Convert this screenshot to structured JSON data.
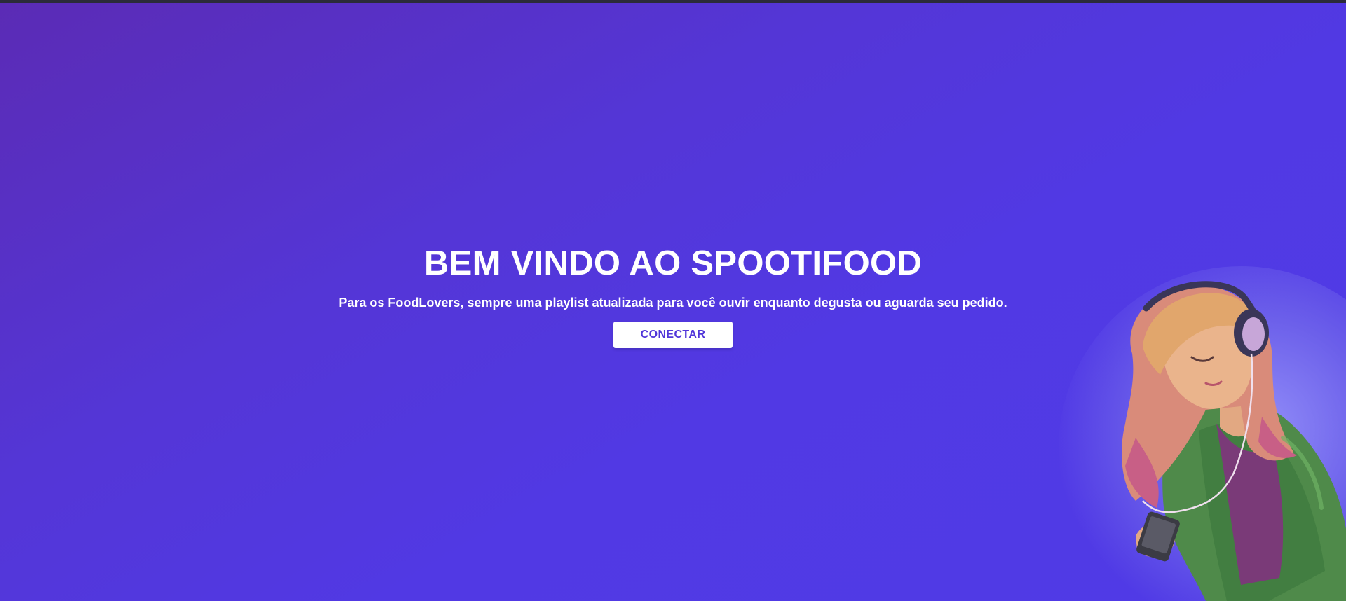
{
  "hero": {
    "title": "BEM VINDO AO SPOOTIFOOD",
    "subtitle": "Para os FoodLovers, sempre uma playlist atualizada para você ouvir enquanto degusta ou aguarda seu pedido.",
    "connect_label": "CONECTAR"
  },
  "illustration": {
    "icon": "girl-with-headphones-illustration"
  },
  "colors": {
    "background_start": "#5b2bb5",
    "background_end": "#503be6",
    "button_text": "#5136d9",
    "button_background": "#ffffff"
  }
}
